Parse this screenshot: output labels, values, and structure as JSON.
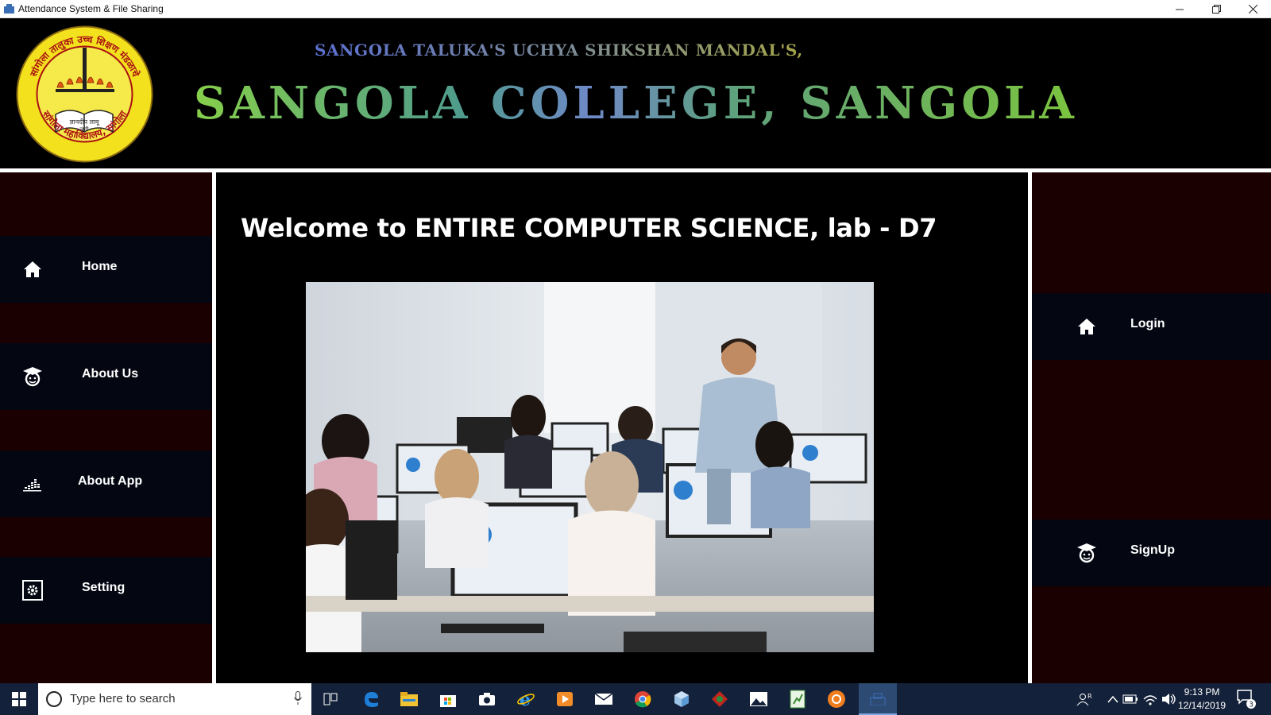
{
  "window": {
    "title": "Attendance System & File Sharing",
    "controls": [
      "minimize",
      "restore",
      "close"
    ]
  },
  "banner": {
    "subtitle": "SANGOLA TALUKA'S UCHYA SHIKSHAN MANDAL'S,",
    "college_name": "SANGOLA COLLEGE, SANGOLA",
    "logo": {
      "outer_text_top": "सांगोला तालुका उच्च शिक्षण मंडळाचे",
      "outer_text_bottom": "सांगोला महाविद्यालय, सांगोला",
      "motto_line1": "ज्ञानदीप लावू",
      "motto_line2": "जगी",
      "ring_color": "#f3e11e",
      "inner_color": "#f6e94a"
    }
  },
  "left_nav": {
    "items": [
      {
        "label": "Home",
        "icon": "home-icon"
      },
      {
        "label": "About Us",
        "icon": "graduate-icon"
      },
      {
        "label": "About App",
        "icon": "equalizer-icon"
      },
      {
        "label": "Setting",
        "icon": "gear-icon"
      }
    ]
  },
  "main": {
    "welcome": "Welcome to ENTIRE COMPUTER SCIENCE, lab - D7",
    "photo_description": "classroom-photo"
  },
  "right_nav": {
    "items": [
      {
        "label": "Login",
        "icon": "home-icon"
      },
      {
        "label": "SignUp",
        "icon": "graduate-icon"
      }
    ]
  },
  "taskbar": {
    "search_placeholder": "Type here to search",
    "time": "9:13 PM",
    "date": "12/14/2019",
    "notification_count": "3",
    "apps": [
      "task-view",
      "edge",
      "file-explorer",
      "store",
      "camera",
      "internet-explorer",
      "media-player",
      "mail",
      "chrome",
      "3d-viewer",
      "app-red",
      "photos",
      "excel-like",
      "firefox-like",
      "active-app"
    ]
  },
  "colors": {
    "panel_bg": "#1a0000",
    "nav_item_bg": "#040612",
    "taskbar_bg": "#14213a"
  }
}
